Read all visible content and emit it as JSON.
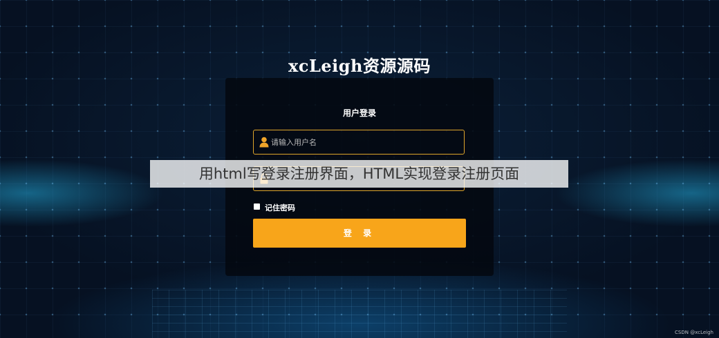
{
  "site_title": "xcLeigh资源源码",
  "login_panel": {
    "title": "用户登录",
    "username_placeholder": "请输入用户名",
    "password_placeholder": "",
    "remember_label": "记住密码",
    "login_button": "登 录"
  },
  "overlay_banner": "用html写登录注册界面，HTML实现登录注册页面",
  "watermark": "CSDN @xcLeigh",
  "colors": {
    "accent": "#f8a51a",
    "field_border": "#e0a62b",
    "background": "#071427"
  },
  "icons": {
    "username": "user-icon",
    "password": "lock-icon"
  }
}
